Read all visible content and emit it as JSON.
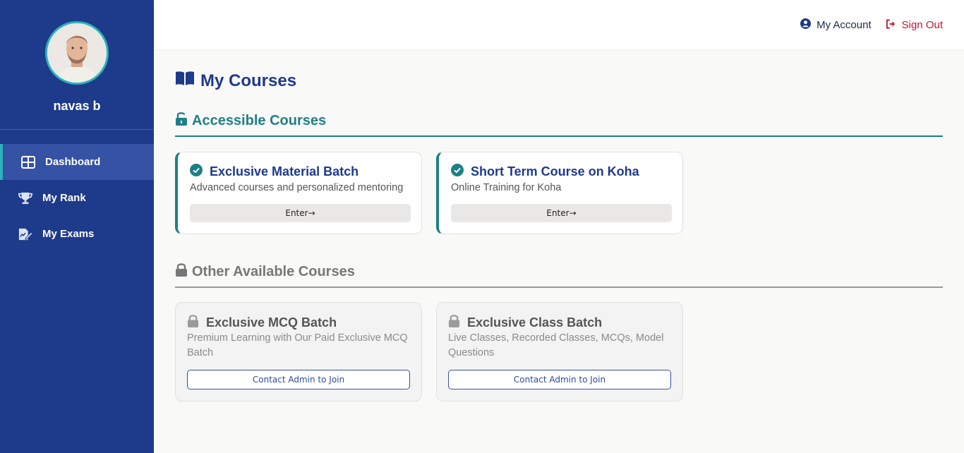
{
  "sidebar": {
    "username": "navas b",
    "items": [
      {
        "label": "Dashboard",
        "icon": "grid-icon",
        "active": true
      },
      {
        "label": "My Rank",
        "icon": "trophy-icon",
        "active": false
      },
      {
        "label": "My Exams",
        "icon": "exam-edit-icon",
        "active": false
      }
    ]
  },
  "topbar": {
    "account_label": "My Account",
    "signout_label": "Sign Out"
  },
  "main": {
    "title": "My Courses",
    "accessible": {
      "heading": "Accessible Courses",
      "courses": [
        {
          "title": "Exclusive Material Batch",
          "description": "Advanced courses and personalized mentoring",
          "button": "Enter→"
        },
        {
          "title": "Short Term Course on Koha",
          "description": "Online Training for Koha",
          "button": "Enter→"
        }
      ]
    },
    "other": {
      "heading": "Other Available Courses",
      "courses": [
        {
          "title": "Exclusive MCQ Batch",
          "description": "Premium Learning with Our Paid Exclusive MCQ Batch",
          "button": "Contact Admin to Join"
        },
        {
          "title": "Exclusive Class Batch",
          "description": "Live Classes, Recorded Classes, MCQs, Model Questions",
          "button": "Contact Admin to Join"
        }
      ]
    }
  },
  "colors": {
    "sidebar_bg": "#1e3a8a",
    "accent_teal": "#1f7f86",
    "signout_red": "#c0182e"
  }
}
